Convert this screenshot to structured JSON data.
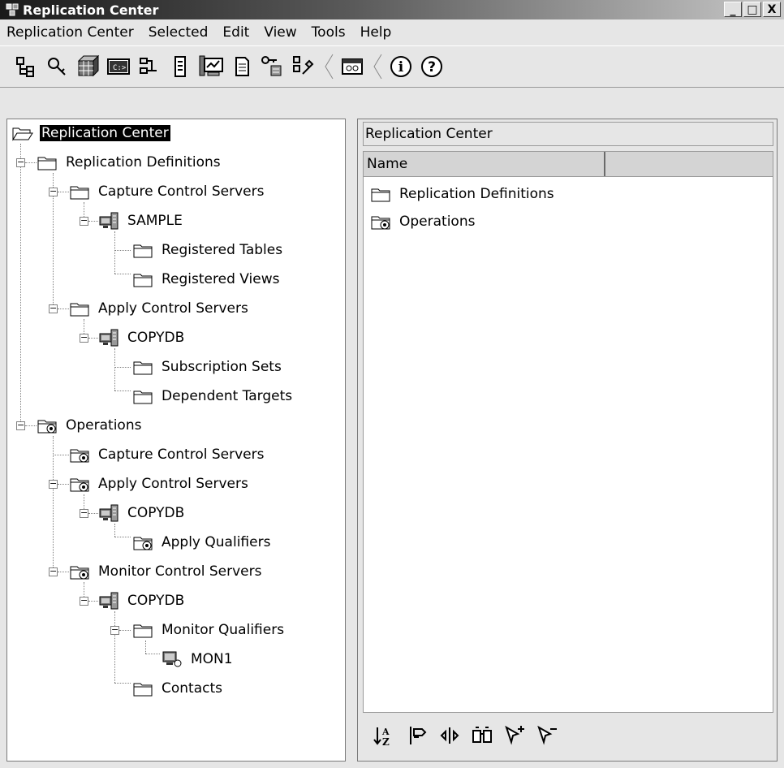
{
  "window": {
    "title": "Replication Center",
    "buttons": [
      "_",
      "□",
      "X"
    ]
  },
  "menu": [
    {
      "label": "Replication Center"
    },
    {
      "label": "Selected"
    },
    {
      "label": "Edit"
    },
    {
      "label": "View"
    },
    {
      "label": "Tools"
    },
    {
      "label": "Help"
    }
  ],
  "toolbar": {
    "icons": [
      "hierarchy-icon",
      "search-key-icon",
      "grid-cube-icon",
      "command-icon",
      "connections-icon",
      "list-icon",
      "monitor-icon",
      "notepad-icon",
      "key-server-icon",
      "tools-icon",
      "window-icon",
      "info-icon",
      "help-icon"
    ]
  },
  "tree": {
    "root": "Replication Center",
    "nodes": [
      "Replication Definitions",
      "Capture Control Servers",
      "SAMPLE",
      "Registered Tables",
      "Registered Views",
      "Apply Control Servers",
      "COPYDB",
      "Subscription Sets",
      "Dependent Targets",
      "Operations",
      "Capture Control Servers",
      "Apply Control Servers",
      "COPYDB",
      "Apply Qualifiers",
      "Monitor Control Servers",
      "COPYDB",
      "Monitor Qualifiers",
      "MON1",
      "Contacts"
    ]
  },
  "detail": {
    "title": "Replication Center",
    "columns": [
      "Name"
    ],
    "items": [
      "Replication Definitions",
      "Operations"
    ]
  },
  "detail_toolbar": {
    "icons": [
      "sort-az-icon",
      "filter-icon",
      "columns-icon",
      "find-icon",
      "select-all-icon",
      "deselect-all-icon"
    ]
  },
  "colors": {
    "selection": "#000000",
    "pane_bg": "#ffffff",
    "chrome_bg": "#e6e6e6"
  }
}
